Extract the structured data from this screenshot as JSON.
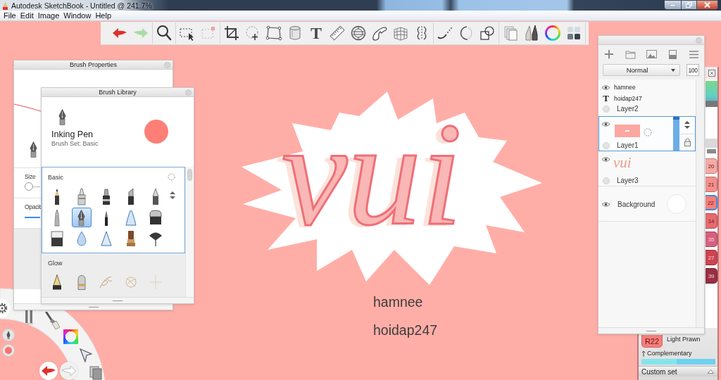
{
  "window": {
    "title": "Autodesk SketchBook - Untitled @ 241.7%"
  },
  "menu": [
    "File",
    "Edit",
    "Image",
    "Window",
    "Help"
  ],
  "toolbar": {
    "text_tool": "T"
  },
  "brush_properties": {
    "title": "Brush Properties",
    "size": {
      "label": "Size",
      "level": 0
    },
    "opacity": {
      "label": "Opacit",
      "level": 1
    }
  },
  "brush_library": {
    "title": "Brush Library",
    "brush_name": "Inking Pen",
    "brush_set": "Brush Set: Basic",
    "sets": [
      {
        "name": "Basic",
        "brushes": [
          {
            "selected": false
          },
          {
            "selected": false
          },
          {
            "selected": false
          },
          {
            "selected": false
          },
          {
            "selected": false
          },
          {
            "selected": false
          },
          {
            "selected": true
          },
          {
            "selected": false
          },
          {
            "selected": false
          },
          {
            "selected": false
          },
          {
            "selected": false
          },
          {
            "selected": false
          },
          {
            "selected": false
          },
          {
            "selected": false
          },
          {
            "selected": false
          }
        ]
      },
      {
        "name": "Glow",
        "brushes": [
          {
            "selected": false
          },
          {
            "selected": false
          },
          {
            "selected": false
          },
          {
            "selected": false
          },
          {
            "selected": false
          }
        ]
      }
    ]
  },
  "layers": {
    "blend_mode": "Normal",
    "opacity": "100",
    "items": [
      {
        "kind": "text",
        "lines": [
          "hamnee",
          "hoidap247"
        ],
        "glyph": "T",
        "name": "Layer2",
        "visible": true,
        "selected": false
      },
      {
        "kind": "fill",
        "name": "Layer1",
        "visible": true,
        "selected": true
      },
      {
        "kind": "sketch",
        "thumbnail_text": "vui",
        "name": "Layer3",
        "visible": true,
        "selected": false
      },
      {
        "kind": "background",
        "name": "Background",
        "visible": true,
        "selected": false
      }
    ]
  },
  "copic": {
    "swatches": [
      {
        "label": "20",
        "color": "#f7aaa6",
        "selected": false
      },
      {
        "label": "21",
        "color": "#f3908d",
        "selected": false
      },
      {
        "label": "22",
        "color": "#f77e7a",
        "selected": true
      },
      {
        "label": "14",
        "color": "#e66a6e",
        "selected": false
      },
      {
        "label": "35",
        "color": "#d5607f",
        "selected": false
      },
      {
        "label": "27",
        "color": "#cd4450",
        "selected": false
      },
      {
        "label": "39",
        "color": "#9a2e42",
        "selected": false
      }
    ],
    "current_code": "R22",
    "current_name": "Light Prawn",
    "complementary": "Complementary",
    "custom_set": "Custom set"
  },
  "canvas": {
    "lettering": "vui",
    "texts": [
      "hamnee",
      "hoidap247"
    ]
  }
}
